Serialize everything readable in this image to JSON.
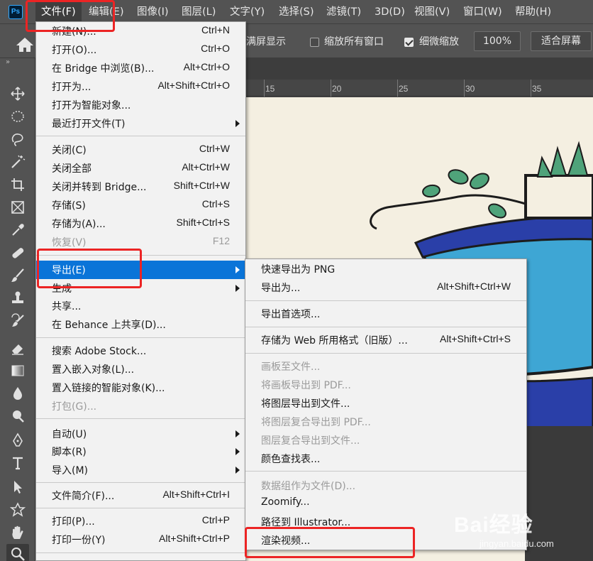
{
  "app": {
    "logo": "Ps"
  },
  "menubar": {
    "items": [
      {
        "label": "文件(F)"
      },
      {
        "label": "编辑(E)"
      },
      {
        "label": "图像(I)"
      },
      {
        "label": "图层(L)"
      },
      {
        "label": "文字(Y)"
      },
      {
        "label": "选择(S)"
      },
      {
        "label": "滤镜(T)"
      },
      {
        "label": "3D(D)"
      },
      {
        "label": "视图(V)"
      },
      {
        "label": "窗口(W)"
      },
      {
        "label": "帮助(H)"
      }
    ]
  },
  "options": {
    "fullscreen": "满屏显示",
    "zoom_all": "缩放所有窗口",
    "scrubby": "细微缩放",
    "zoom_value": "100%",
    "fit_screen": "适合屏幕"
  },
  "ruler": {
    "ticks": [
      "15",
      "20",
      "25",
      "30",
      "35"
    ]
  },
  "file_menu": {
    "items": [
      {
        "label": "新建(N)...",
        "shortcut": "Ctrl+N"
      },
      {
        "label": "打开(O)...",
        "shortcut": "Ctrl+O"
      },
      {
        "label": "在 Bridge 中浏览(B)...",
        "shortcut": "Alt+Ctrl+O"
      },
      {
        "label": "打开为...",
        "shortcut": "Alt+Shift+Ctrl+O"
      },
      {
        "label": "打开为智能对象...",
        "shortcut": ""
      },
      {
        "label": "最近打开文件(T)",
        "shortcut": ""
      },
      {
        "label": "关闭(C)",
        "shortcut": "Ctrl+W"
      },
      {
        "label": "关闭全部",
        "shortcut": "Alt+Ctrl+W"
      },
      {
        "label": "关闭并转到 Bridge...",
        "shortcut": "Shift+Ctrl+W"
      },
      {
        "label": "存储(S)",
        "shortcut": "Ctrl+S"
      },
      {
        "label": "存储为(A)...",
        "shortcut": "Shift+Ctrl+S"
      },
      {
        "label": "恢复(V)",
        "shortcut": "F12"
      },
      {
        "label": "导出(E)",
        "shortcut": ""
      },
      {
        "label": "生成",
        "shortcut": ""
      },
      {
        "label": "共享...",
        "shortcut": ""
      },
      {
        "label": "在 Behance 上共享(D)...",
        "shortcut": ""
      },
      {
        "label": "搜索 Adobe Stock...",
        "shortcut": ""
      },
      {
        "label": "置入嵌入对象(L)...",
        "shortcut": ""
      },
      {
        "label": "置入链接的智能对象(K)...",
        "shortcut": ""
      },
      {
        "label": "打包(G)...",
        "shortcut": ""
      },
      {
        "label": "自动(U)",
        "shortcut": ""
      },
      {
        "label": "脚本(R)",
        "shortcut": ""
      },
      {
        "label": "导入(M)",
        "shortcut": ""
      },
      {
        "label": "文件简介(F)...",
        "shortcut": "Alt+Shift+Ctrl+I"
      },
      {
        "label": "打印(P)...",
        "shortcut": "Ctrl+P"
      },
      {
        "label": "打印一份(Y)",
        "shortcut": "Alt+Shift+Ctrl+P"
      }
    ]
  },
  "export_menu": {
    "items": [
      {
        "label": "快速导出为 PNG",
        "shortcut": ""
      },
      {
        "label": "导出为...",
        "shortcut": "Alt+Shift+Ctrl+W"
      },
      {
        "label": "导出首选项...",
        "shortcut": ""
      },
      {
        "label": "存储为 Web 所用格式（旧版）...",
        "shortcut": "Alt+Shift+Ctrl+S"
      },
      {
        "label": "画板至文件...",
        "shortcut": ""
      },
      {
        "label": "将画板导出到 PDF...",
        "shortcut": ""
      },
      {
        "label": "将图层导出到文件...",
        "shortcut": ""
      },
      {
        "label": "将图层复合导出到 PDF...",
        "shortcut": ""
      },
      {
        "label": "图层复合导出到文件...",
        "shortcut": ""
      },
      {
        "label": "颜色查找表...",
        "shortcut": ""
      },
      {
        "label": "数据组作为文件(D)...",
        "shortcut": ""
      },
      {
        "label": "Zoomify...",
        "shortcut": ""
      },
      {
        "label": "路径到 Illustrator...",
        "shortcut": ""
      },
      {
        "label": "渲染视频...",
        "shortcut": ""
      }
    ]
  },
  "watermark": {
    "brand": "Bai经验",
    "url": "jingyan.baidu.com"
  },
  "colors": {
    "highlight": "#0a74d8",
    "annotation": "#ec2424",
    "pot": "#2a3fa8",
    "water": "#3ea6d4",
    "leaf": "#4fa37a"
  }
}
